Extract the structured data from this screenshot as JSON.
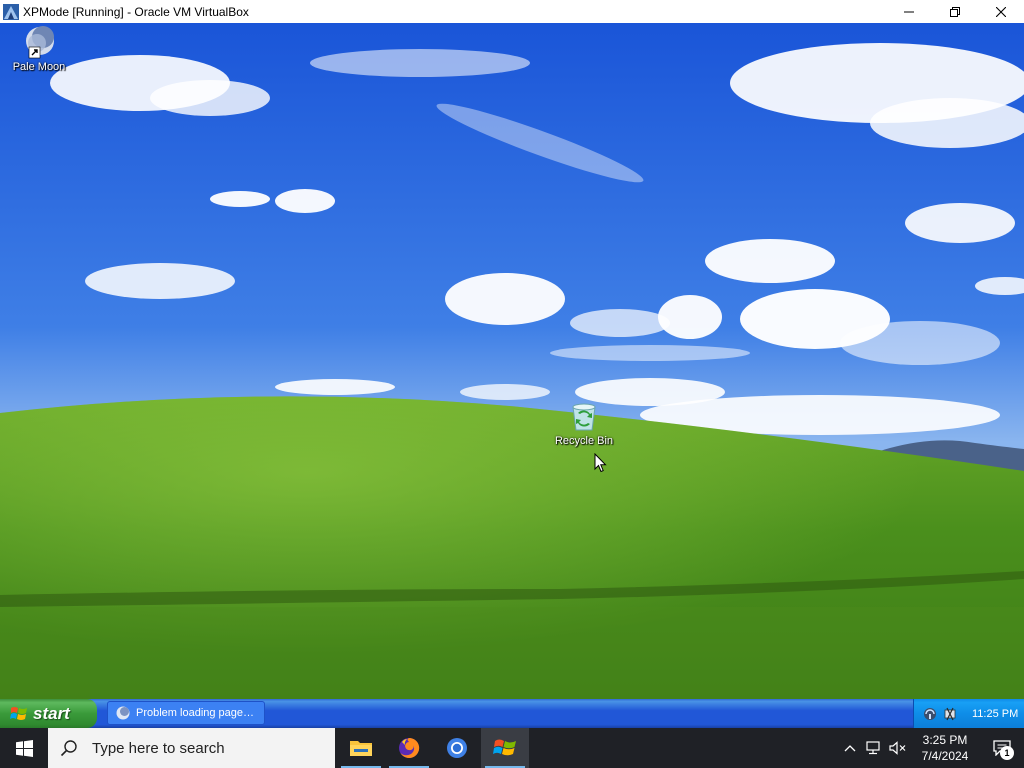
{
  "host_window": {
    "title": "XPMode [Running] - Oracle VM VirtualBox",
    "controls": [
      "minimize",
      "maximize",
      "close"
    ]
  },
  "guest_desktop": {
    "wallpaper": "bliss",
    "icons": [
      {
        "label": "Pale Moon",
        "icon": "pale-moon-icon",
        "shortcut": true
      },
      {
        "label": "Recycle Bin",
        "icon": "recycle-bin-icon"
      }
    ]
  },
  "xp_taskbar": {
    "start_label": "start",
    "tasks": [
      {
        "label": "Problem loading page…",
        "icon": "pale-moon-icon"
      }
    ],
    "tray_icons": [
      "network-icon",
      "safely-remove-icon"
    ],
    "clock": "11:25 PM"
  },
  "host_taskbar": {
    "search_placeholder": "Type here to search",
    "pinned": [
      {
        "name": "file-explorer",
        "running": true
      },
      {
        "name": "firefox",
        "running": true
      },
      {
        "name": "chrome",
        "running": false
      },
      {
        "name": "virtualbox-xp",
        "running": true,
        "active": true
      }
    ],
    "tray_icons": [
      "chevron-up-icon",
      "network-icon",
      "volume-muted-icon"
    ],
    "time": "3:25 PM",
    "date": "7/4/2024",
    "notification_count": "1"
  },
  "colors": {
    "sky_top": "#1a55d8",
    "grass": "#4a8f1c",
    "xp_taskbar": "#2157d7",
    "xp_start": "#3a9a3a",
    "host_taskbar": "#1f2126"
  }
}
